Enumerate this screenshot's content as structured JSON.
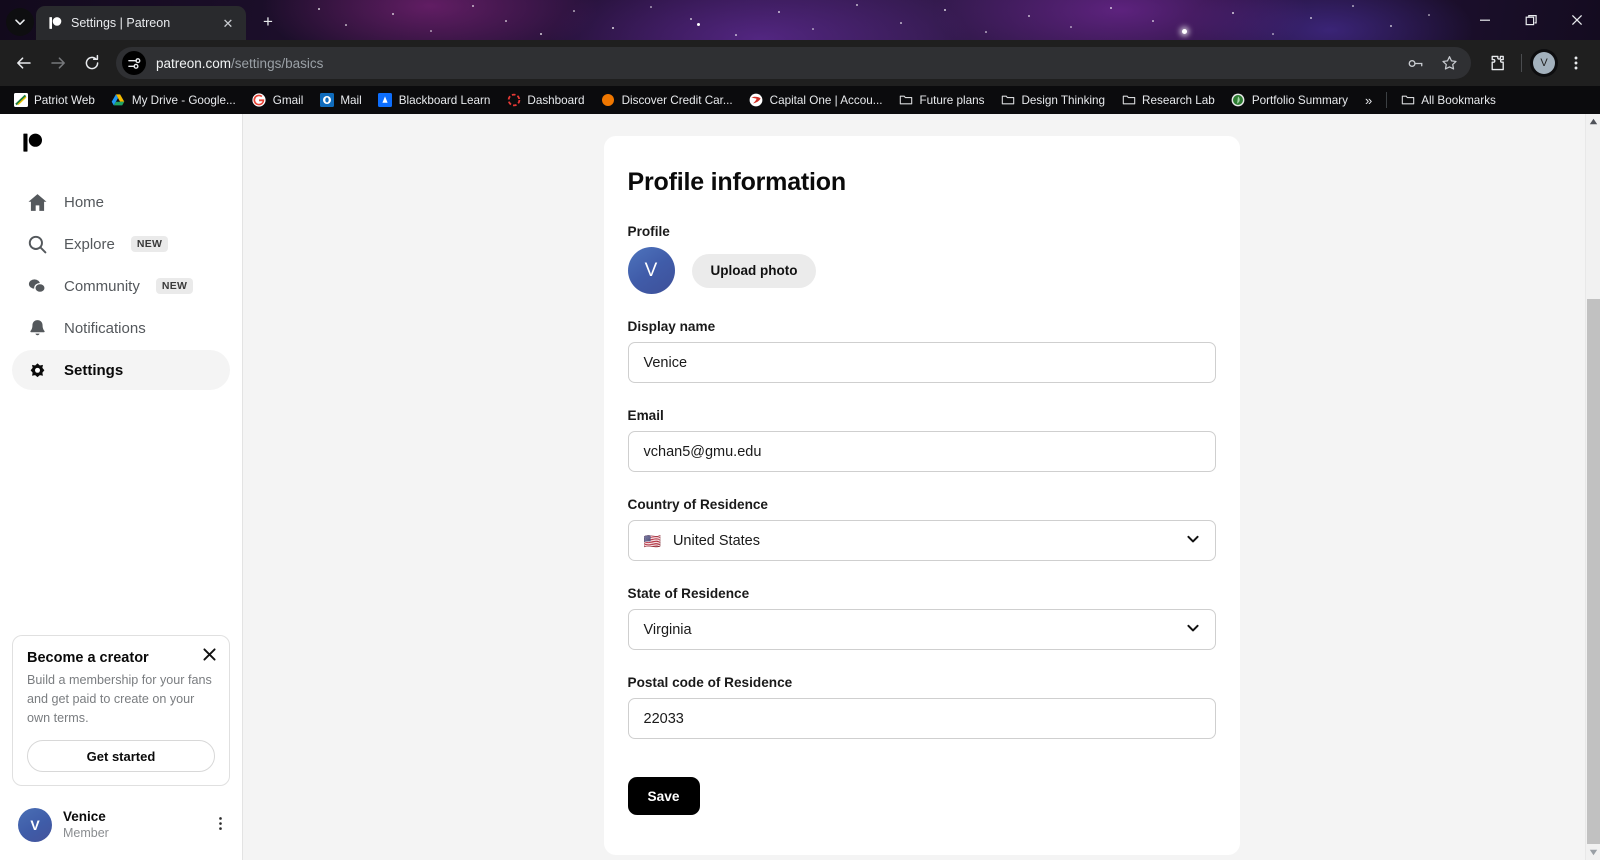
{
  "browser": {
    "tab": {
      "title": "Settings | Patreon",
      "favicon": "patreon-icon",
      "close_label": "✕"
    },
    "new_tab_label": "+",
    "tab_list_icon": "chevron-down-icon",
    "window_controls": {
      "minimize": "—",
      "maximize": "❐",
      "close": "✕"
    },
    "nav": {
      "back": "←",
      "forward": "→",
      "reload": "↻"
    },
    "omnibox": {
      "site_settings_icon": "tune-icon",
      "url_domain": "patreon.com",
      "url_path": "/settings/basics",
      "password_icon": "key-icon",
      "bookmark_icon": "star-icon",
      "extensions_icon": "puzzle-icon",
      "profile_initial": "V",
      "menu_icon": "three-dots-vertical-icon"
    },
    "bookmarks": [
      {
        "label": "Patriot Web",
        "icon": "patriot-web-icon"
      },
      {
        "label": "My Drive - Google...",
        "icon": "google-drive-icon"
      },
      {
        "label": "Gmail",
        "icon": "gmail-icon"
      },
      {
        "label": "Mail",
        "icon": "outlook-icon"
      },
      {
        "label": "Blackboard Learn",
        "icon": "blackboard-icon"
      },
      {
        "label": "Dashboard",
        "icon": "dashboard-icon"
      },
      {
        "label": "Discover Credit Car...",
        "icon": "discover-icon"
      },
      {
        "label": "Capital One | Accou...",
        "icon": "capital-one-icon"
      },
      {
        "label": "Future plans",
        "icon": "folder-icon"
      },
      {
        "label": "Design Thinking",
        "icon": "folder-icon"
      },
      {
        "label": "Research Lab",
        "icon": "folder-icon"
      },
      {
        "label": "Portfolio Summary",
        "icon": "portfolio-icon"
      }
    ],
    "bookmarks_overflow": "»",
    "all_bookmarks": {
      "label": "All Bookmarks",
      "icon": "folder-icon"
    }
  },
  "sidebar": {
    "logo": "patreon-logo",
    "items": [
      {
        "label": "Home",
        "icon": "home-icon",
        "badge": "",
        "active": false
      },
      {
        "label": "Explore",
        "icon": "search-icon",
        "badge": "NEW",
        "active": false
      },
      {
        "label": "Community",
        "icon": "chat-bubbles-icon",
        "badge": "NEW",
        "active": false
      },
      {
        "label": "Notifications",
        "icon": "bell-icon",
        "badge": "",
        "active": false
      },
      {
        "label": "Settings",
        "icon": "gear-icon",
        "badge": "",
        "active": true
      }
    ],
    "creator_card": {
      "title": "Become a creator",
      "body": "Build a membership for your fans and get paid to create on your own terms.",
      "button": "Get started",
      "close": "✕"
    },
    "user": {
      "initial": "V",
      "name": "Venice",
      "role": "Member",
      "menu_icon": "three-dots-vertical-icon"
    }
  },
  "main": {
    "title": "Profile information",
    "profile": {
      "label": "Profile",
      "avatar_initial": "V",
      "upload_button": "Upload photo"
    },
    "fields": [
      {
        "label": "Display name",
        "value": "Venice",
        "type": "text"
      },
      {
        "label": "Email",
        "value": "vchan5@gmu.edu",
        "type": "text"
      },
      {
        "label": "Country of Residence",
        "value": "United States",
        "type": "select",
        "flag": "🇺🇸"
      },
      {
        "label": "State of Residence",
        "value": "Virginia",
        "type": "select",
        "flag": ""
      },
      {
        "label": "Postal code of Residence",
        "value": "22033",
        "type": "text"
      }
    ],
    "save_button": "Save"
  },
  "colors": {
    "accent_black": "#000000",
    "page_bg": "#f4f4f4",
    "card_bg": "#ffffff",
    "avatar_blue": "#4460ab",
    "chrome_dark": "#1f1f1f"
  }
}
